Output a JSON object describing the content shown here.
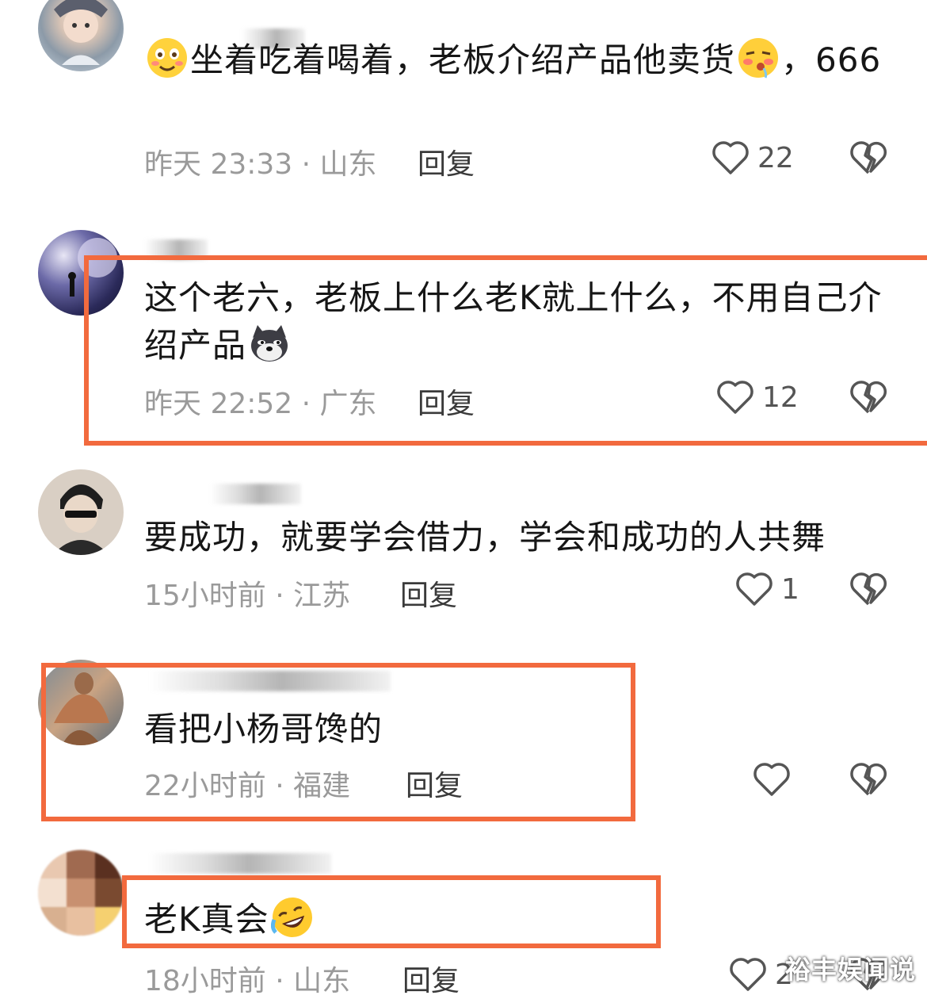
{
  "comments": [
    {
      "text_before": "",
      "text_mid": "坐着吃着喝着，老板介绍产品他卖货",
      "text_after": "，666",
      "time": "昨天 23:33 · 山东",
      "reply": "回复",
      "likes": "22",
      "emoji_lead": "smile-blush-emoji",
      "emoji_inline": "drool-face-emoji"
    },
    {
      "text": "这个老六，老板上什么老K就上什么，不用自己介绍产品",
      "time": "昨天 22:52 · 广东",
      "reply": "回复",
      "likes": "12",
      "emoji_inline": "doge-emoji"
    },
    {
      "text": "要成功，就要学会借力，学会和成功的人共舞",
      "time": "15小时前 · 江苏",
      "reply": "回复",
      "likes": "1"
    },
    {
      "text": "看把小杨哥馋的",
      "time": "22小时前 · 福建",
      "reply": "回复",
      "likes": ""
    },
    {
      "text": "老K真会",
      "time": "18小时前 · 山东",
      "reply": "回复",
      "likes": "2",
      "emoji_inline": "rofl-emoji"
    }
  ],
  "watermark": "裕丰娱闻说",
  "colors": {
    "highlight": "#f26a3e",
    "meta": "#9a9a9a",
    "text": "#161616"
  }
}
